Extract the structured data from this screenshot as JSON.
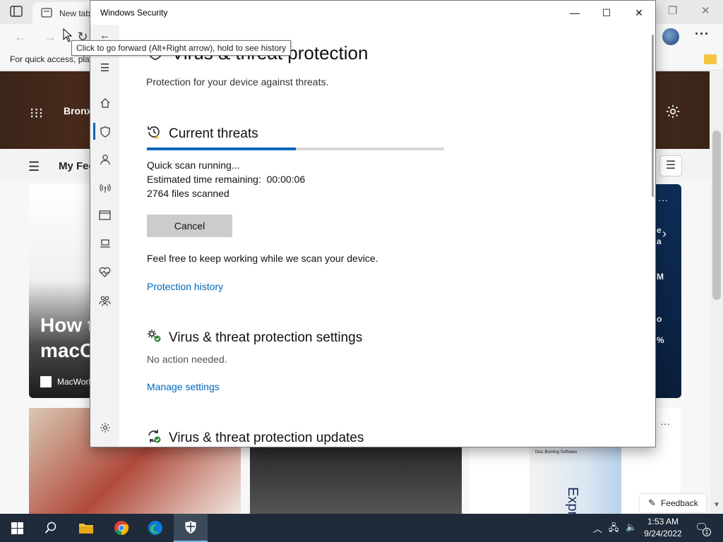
{
  "browser": {
    "tab_label": "New tab",
    "favorites_bar_text": "For quick access, pla",
    "hero_city": "Bronx",
    "feed_title": "My Fee",
    "left_card_title": "How t\nmacO",
    "left_card_source": "MacWorl",
    "right_card_lines": [
      "e",
      "a",
      "M",
      "o",
      "%"
    ],
    "product_box_text": "Disc Burning Software",
    "product_express": "Express",
    "feedback_label": "Feedback"
  },
  "tooltip": {
    "text": "Click to go forward (Alt+Right arrow), hold to see history"
  },
  "security_window": {
    "title": "Windows Security",
    "page_title": "Virus & threat protection",
    "page_subtitle": "Protection for your device against threats.",
    "current_threats": {
      "heading": "Current threats",
      "progress_fraction": 0.5,
      "status": "Quick scan running...",
      "time_remaining": "Estimated time remaining:  00:00:06",
      "files_scanned": "2764 files scanned",
      "cancel_label": "Cancel",
      "note": "Feel free to keep working while we scan your device.",
      "history_link": "Protection history"
    },
    "settings": {
      "heading": "Virus & threat protection settings",
      "status": "No action needed.",
      "manage_link": "Manage settings"
    },
    "updates": {
      "heading": "Virus & threat protection updates"
    },
    "sidebar": [
      {
        "name": "menu",
        "icon": "hamburger-icon"
      },
      {
        "name": "home",
        "icon": "home-icon"
      },
      {
        "name": "virus-protection",
        "icon": "shield-icon"
      },
      {
        "name": "account-protection",
        "icon": "person-icon"
      },
      {
        "name": "firewall-network",
        "icon": "antenna-icon"
      },
      {
        "name": "app-browser-control",
        "icon": "browser-window-icon"
      },
      {
        "name": "device-security",
        "icon": "laptop-icon"
      },
      {
        "name": "device-performance",
        "icon": "heart-pulse-icon"
      },
      {
        "name": "family-options",
        "icon": "family-icon"
      },
      {
        "name": "settings",
        "icon": "gear-icon"
      }
    ]
  },
  "taskbar": {
    "time": "1:53 AM",
    "date": "9/24/2022",
    "notification_count": "1"
  },
  "colors": {
    "accent": "#0067b8",
    "taskbar": "#1f2b3a"
  }
}
